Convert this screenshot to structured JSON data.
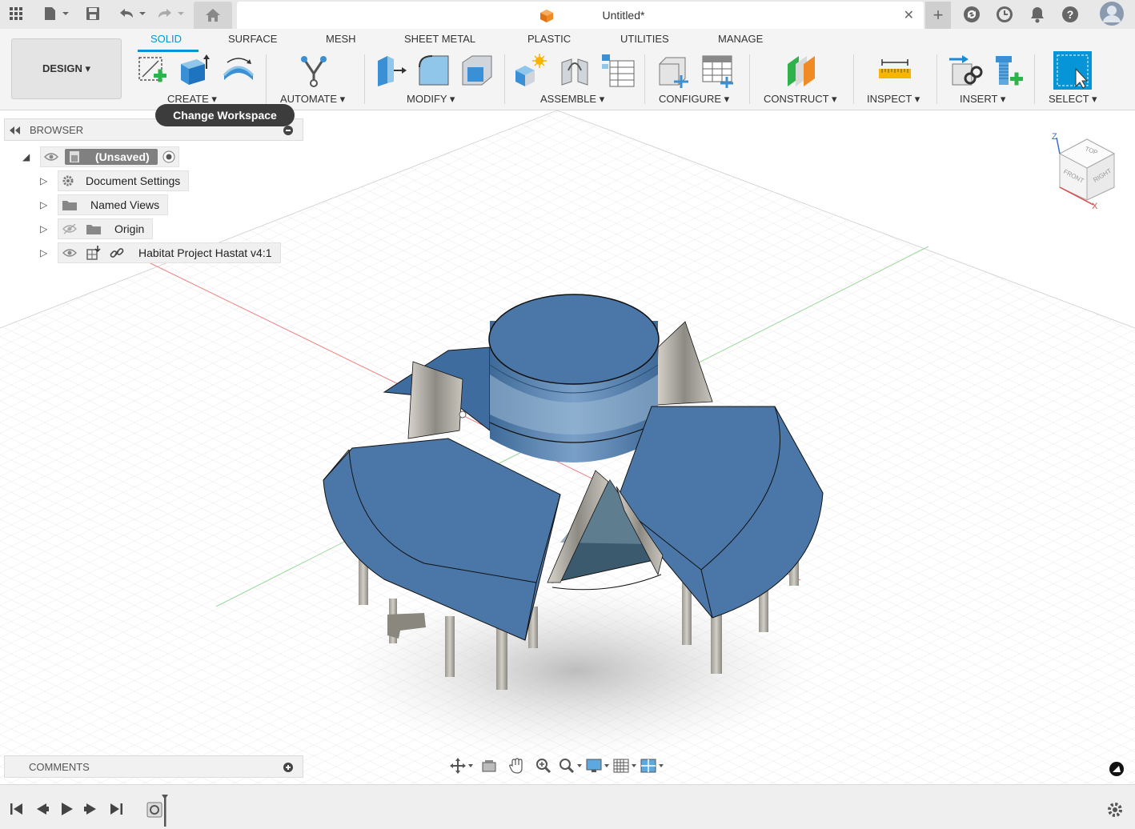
{
  "titlebar": {
    "doc_title": "Untitled*",
    "close_symbol": "✕",
    "new_tab_symbol": "+"
  },
  "toolbar": {
    "workspace_button": "DESIGN ▾",
    "tabs": [
      "SOLID",
      "SURFACE",
      "MESH",
      "SHEET METAL",
      "PLASTIC",
      "UTILITIES",
      "MANAGE"
    ],
    "active_tab": "SOLID",
    "groups": {
      "create": "CREATE ▾",
      "automate": "AUTOMATE ▾",
      "modify": "MODIFY ▾",
      "assemble": "ASSEMBLE ▾",
      "configure": "CONFIGURE ▾",
      "construct": "CONSTRUCT ▾",
      "inspect": "INSPECT ▾",
      "insert": "INSERT ▾",
      "select": "SELECT ▾"
    },
    "tooltip": "Change Workspace"
  },
  "browser": {
    "header": "BROWSER",
    "root": "(Unsaved)",
    "items": [
      "Document Settings",
      "Named Views",
      "Origin",
      "Habitat Project Hastat v4:1"
    ]
  },
  "comments": {
    "header": "COMMENTS"
  },
  "viewcube": {
    "top": "TOP",
    "front": "FRONT",
    "right": "RIGHT",
    "axis_z": "Z",
    "axis_x": "X"
  },
  "colors": {
    "accent": "#0696d7",
    "model_blue": "#4a77a8",
    "grid_line": "#d9d9d9"
  }
}
